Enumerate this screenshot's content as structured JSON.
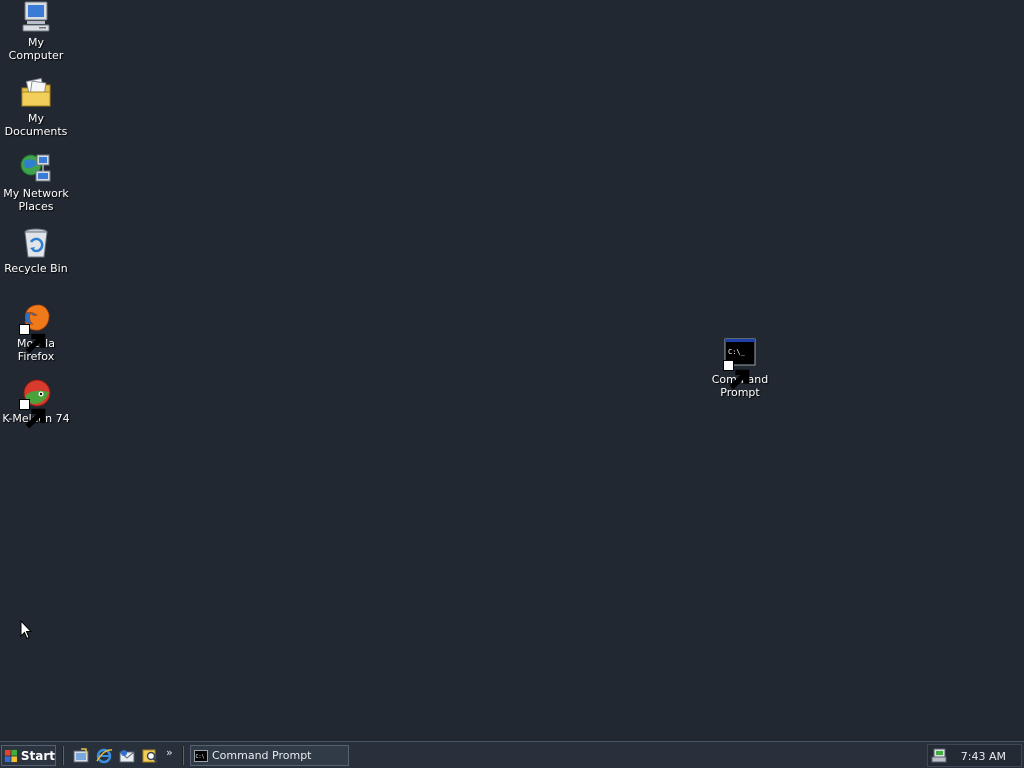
{
  "desktop": {
    "icons": [
      {
        "label": "My Computer",
        "icon": "my-computer-icon"
      },
      {
        "label": "My Documents",
        "icon": "my-documents-icon"
      },
      {
        "label": "My Network Places",
        "icon": "network-places-icon"
      },
      {
        "label": "Recycle Bin",
        "icon": "recycle-bin-icon"
      },
      {
        "label": "Mozilla Firefox",
        "icon": "firefox-icon"
      },
      {
        "label": "K-Meleon 74",
        "icon": "k-meleon-icon"
      },
      {
        "label": "Command Prompt",
        "icon": "command-prompt-icon"
      }
    ]
  },
  "taskbar": {
    "start_label": "Start",
    "quick_launch": [
      "show-desktop-icon",
      "internet-explorer-icon",
      "outlook-express-icon",
      "search-icon"
    ],
    "more_label": "»",
    "tasks": [
      {
        "label": "Command Prompt",
        "icon": "command-prompt-icon"
      }
    ],
    "clock": "7:43 AM"
  },
  "colors": {
    "desktop_background": "#222831",
    "taskbar_background": "#28303b",
    "label_text": "#ffffff"
  }
}
